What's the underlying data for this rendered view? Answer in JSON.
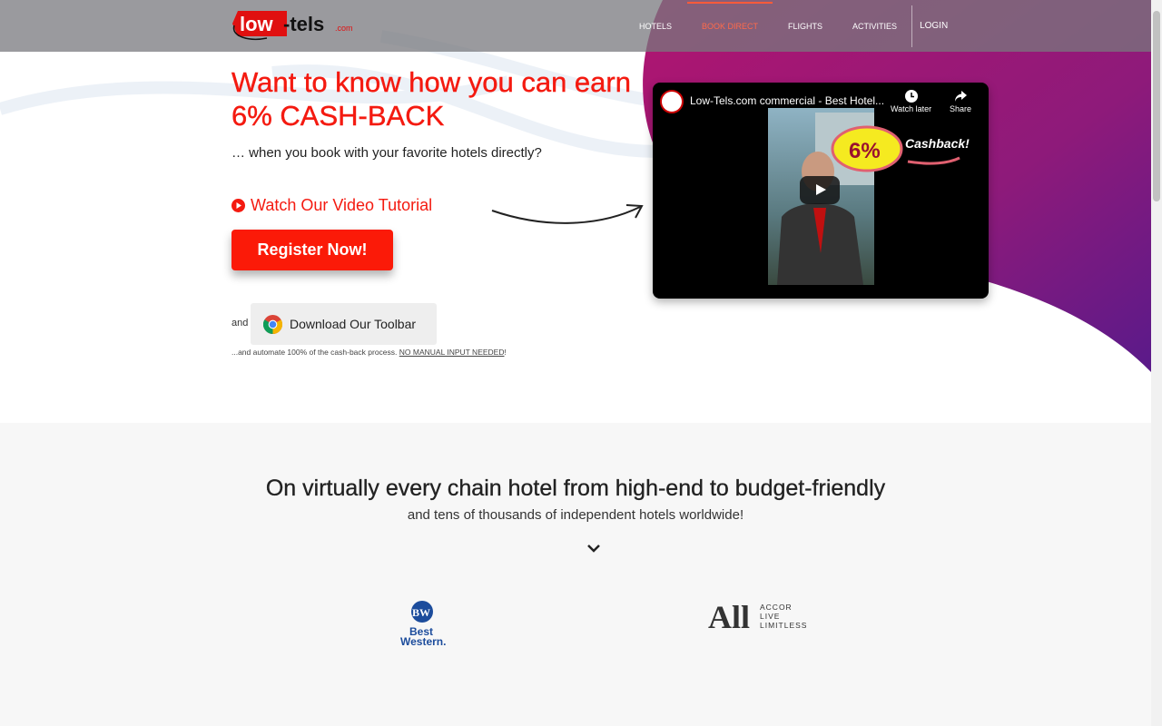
{
  "brand": {
    "name": "low-tels",
    "tld": ".com",
    "colors": {
      "accent": "#f41a10",
      "purple": "#7a1060"
    }
  },
  "nav": {
    "items": [
      {
        "label": "HOTELS"
      },
      {
        "label": "BOOK DIRECT",
        "active": true
      },
      {
        "label": "FLIGHTS"
      },
      {
        "label": "ACTIVITIES"
      }
    ],
    "login": "LOGIN"
  },
  "hero": {
    "title": "Want to know how you can earn 6% CASH-BACK",
    "subtitle": "… when you book with your favorite hotels directly?",
    "watch_link": "Watch Our Video Tutorial",
    "register": "Register Now!",
    "and": "and",
    "toolbar_button": "Download Our Toolbar",
    "automate_text": "...and automate 100% of the cash-back process.",
    "automate_link": "NO MANUAL INPUT NEEDED",
    "automate_end": "!"
  },
  "video": {
    "title": "Low-Tels.com commercial - Best Hotel...",
    "watch_later": "Watch later",
    "share": "Share",
    "overlay_percent": "6%",
    "overlay_text": "Cashback!"
  },
  "section": {
    "title": "On virtually every chain hotel from high-end to budget-friendly",
    "subtitle": "and tens of thousands of independent hotels worldwide!"
  },
  "partners": [
    {
      "name": "Best Western",
      "mono": "BW",
      "line1": "Best",
      "line2": "Western."
    },
    {
      "name": "ALL Accor",
      "mark": "All",
      "lines": [
        "ACCOR",
        "LIVE",
        "LIMITLESS"
      ]
    }
  ]
}
